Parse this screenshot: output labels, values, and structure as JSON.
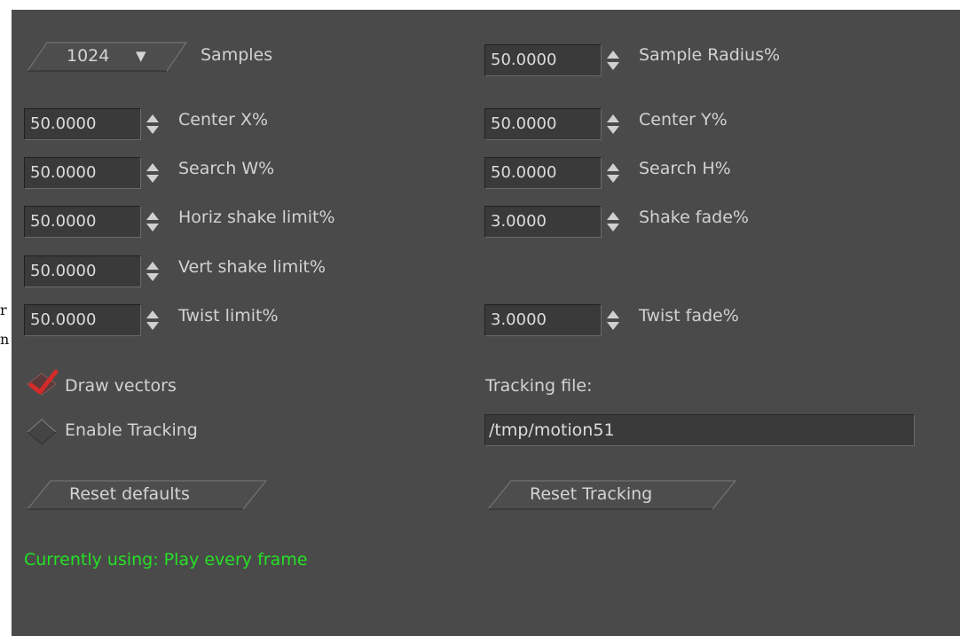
{
  "edge": {
    "char1": "r",
    "char2": "n"
  },
  "samples": {
    "value": "1024",
    "arrow": "▼",
    "label": "Samples"
  },
  "sample_radius": {
    "value": "50.0000",
    "label": "Sample Radius%"
  },
  "center_x": {
    "value": "50.0000",
    "label": "Center X%"
  },
  "center_y": {
    "value": "50.0000",
    "label": "Center Y%"
  },
  "search_w": {
    "value": "50.0000",
    "label": "Search W%"
  },
  "search_h": {
    "value": "50.0000",
    "label": "Search H%"
  },
  "horiz_shake": {
    "value": "50.0000",
    "label": "Horiz shake limit%"
  },
  "shake_fade": {
    "value": "3.0000",
    "label": "Shake fade%"
  },
  "vert_shake": {
    "value": "50.0000",
    "label": "Vert shake limit%"
  },
  "twist_limit": {
    "value": "50.0000",
    "label": "Twist limit%"
  },
  "twist_fade": {
    "value": "3.0000",
    "label": "Twist fade%"
  },
  "draw_vectors": {
    "label": "Draw vectors",
    "checked": true
  },
  "enable_tracking": {
    "label": "Enable Tracking",
    "checked": false
  },
  "tracking_file": {
    "label": "Tracking file:",
    "value": "/tmp/motion51"
  },
  "buttons": {
    "reset_defaults": "Reset defaults",
    "reset_tracking": "Reset Tracking"
  },
  "status": {
    "text": "Currently using: Play every frame"
  },
  "colors": {
    "panel": "#4a4a4a",
    "field": "#3a3a3a",
    "text": "#d2d2d2",
    "status": "#25e025",
    "check": "#d42a2a"
  }
}
